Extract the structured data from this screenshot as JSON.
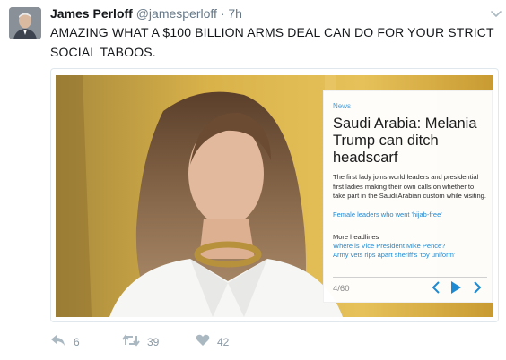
{
  "tweet": {
    "author_name": "James Perloff",
    "handle": "@jamesperloff",
    "separator": "·",
    "time": "7h",
    "text": "AMAZING WHAT A $100 BILLION ARMS DEAL CAN DO FOR YOUR STRICT SOCIAL TABOOS."
  },
  "card": {
    "label": "News",
    "headline": "Saudi Arabia: Melania Trump can ditch headscarf",
    "summary": "The first lady joins world leaders and presidential first ladies making their own calls on whether to take part in the Saudi Arabian custom while visiting.",
    "link": "Female leaders who went 'hijab-free'",
    "more_headlines_label": "More headlines",
    "more_headlines": [
      "Where is Vice President Mike Pence?",
      "Army vets rips apart sheriff's 'toy uniform'"
    ],
    "counter": "4/60"
  },
  "actions": {
    "reply_count": "6",
    "retweet_count": "39",
    "like_count": "42"
  },
  "colors": {
    "link": "#1f8ad1",
    "label": "#4a9fd8",
    "muted": "#657786",
    "action": "#8899a6"
  },
  "icons": {
    "caret": "chevron-down-icon",
    "prev": "chevron-left-icon",
    "play": "play-icon",
    "next": "chevron-right-icon",
    "reply": "reply-icon",
    "retweet": "retweet-icon",
    "like": "heart-icon"
  }
}
